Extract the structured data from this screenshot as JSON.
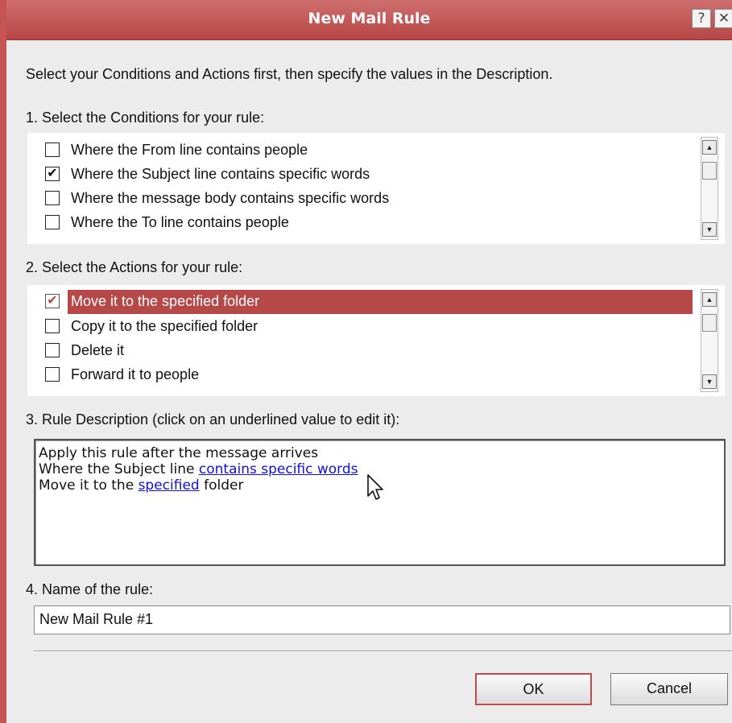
{
  "window": {
    "title": "New Mail Rule",
    "help_glyph": "?",
    "close_glyph": "✕"
  },
  "intro": "Select your Conditions and Actions first, then specify the values in the Description.",
  "conditions": {
    "label": "1. Select the Conditions for your rule:",
    "items": [
      {
        "label": "Where the From line contains people",
        "checked": false
      },
      {
        "label": "Where the Subject line contains specific words",
        "checked": true
      },
      {
        "label": "Where the message body contains specific words",
        "checked": false
      },
      {
        "label": "Where the To line contains people",
        "checked": false
      }
    ]
  },
  "actions": {
    "label": "2. Select the Actions for your rule:",
    "items": [
      {
        "label": "Move it to the specified folder",
        "checked": true,
        "selected": true
      },
      {
        "label": "Copy it to the specified folder",
        "checked": false
      },
      {
        "label": "Delete it",
        "checked": false
      },
      {
        "label": "Forward it to people",
        "checked": false
      }
    ]
  },
  "description": {
    "label": "3. Rule Description (click on an underlined value to edit it):",
    "line1": "Apply this rule after the message arrives",
    "line2_prefix": "Where the Subject line ",
    "line2_link": "contains specific words",
    "line3_prefix": "Move it to the ",
    "line3_link": "specified",
    "line3_suffix": " folder"
  },
  "rule_name": {
    "label": "4. Name of the rule:",
    "value": "New Mail Rule #1"
  },
  "buttons": {
    "ok": "OK",
    "cancel": "Cancel"
  },
  "colors": {
    "accent": "#b64848",
    "link": "#1010d8"
  },
  "icons": {
    "check": "✔",
    "scroll_up": "▲",
    "scroll_down": "▼"
  }
}
